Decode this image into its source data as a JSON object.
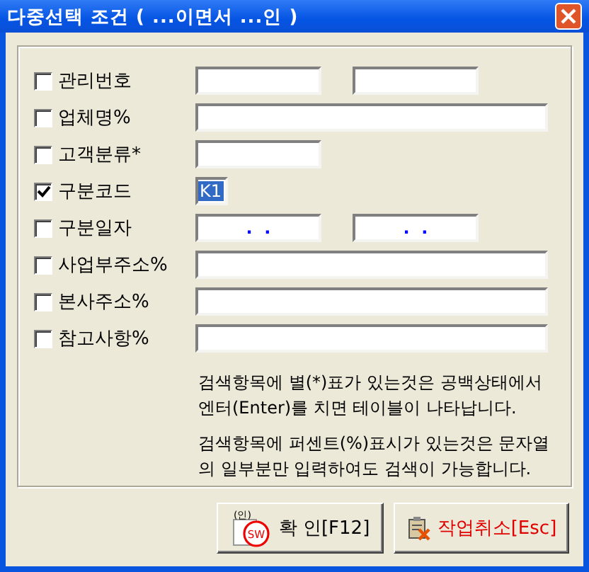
{
  "window": {
    "title": "다중선택 조건 ( ...이면서 ...인 )"
  },
  "rows": [
    {
      "label": "관리번호",
      "checked": false,
      "kind": "pair"
    },
    {
      "label": "업체명%",
      "checked": false,
      "kind": "wide"
    },
    {
      "label": "고객분류*",
      "checked": false,
      "kind": "single"
    },
    {
      "label": "구분코드",
      "checked": true,
      "kind": "code",
      "fields": [
        {
          "value": "K1",
          "selected": true
        }
      ]
    },
    {
      "label": "구분일자",
      "checked": false,
      "kind": "date-pair",
      "fields": [
        {
          "value": ".  ."
        },
        {
          "value": ".  ."
        }
      ]
    },
    {
      "label": "사업부주소%",
      "checked": false,
      "kind": "wide"
    },
    {
      "label": "본사주소%",
      "checked": false,
      "kind": "wide"
    },
    {
      "label": "참고사항%",
      "checked": false,
      "kind": "wide"
    }
  ],
  "help": [
    "검색항목에 별(*)표가 있는것은 공백상태에서 엔터(Enter)를 치면 테이블이 나타납니다.",
    "검색항목에 퍼센트(%)표시가 있는것은 문자열의 일부분만 입력하여도 검색이 가능합니다."
  ],
  "buttons": [
    {
      "label": "확 인[F12]",
      "kind": "confirm",
      "stamp_top": "(인)",
      "stamp": "SW"
    },
    {
      "label": "작업취소[Esc]",
      "kind": "cancel"
    }
  ]
}
